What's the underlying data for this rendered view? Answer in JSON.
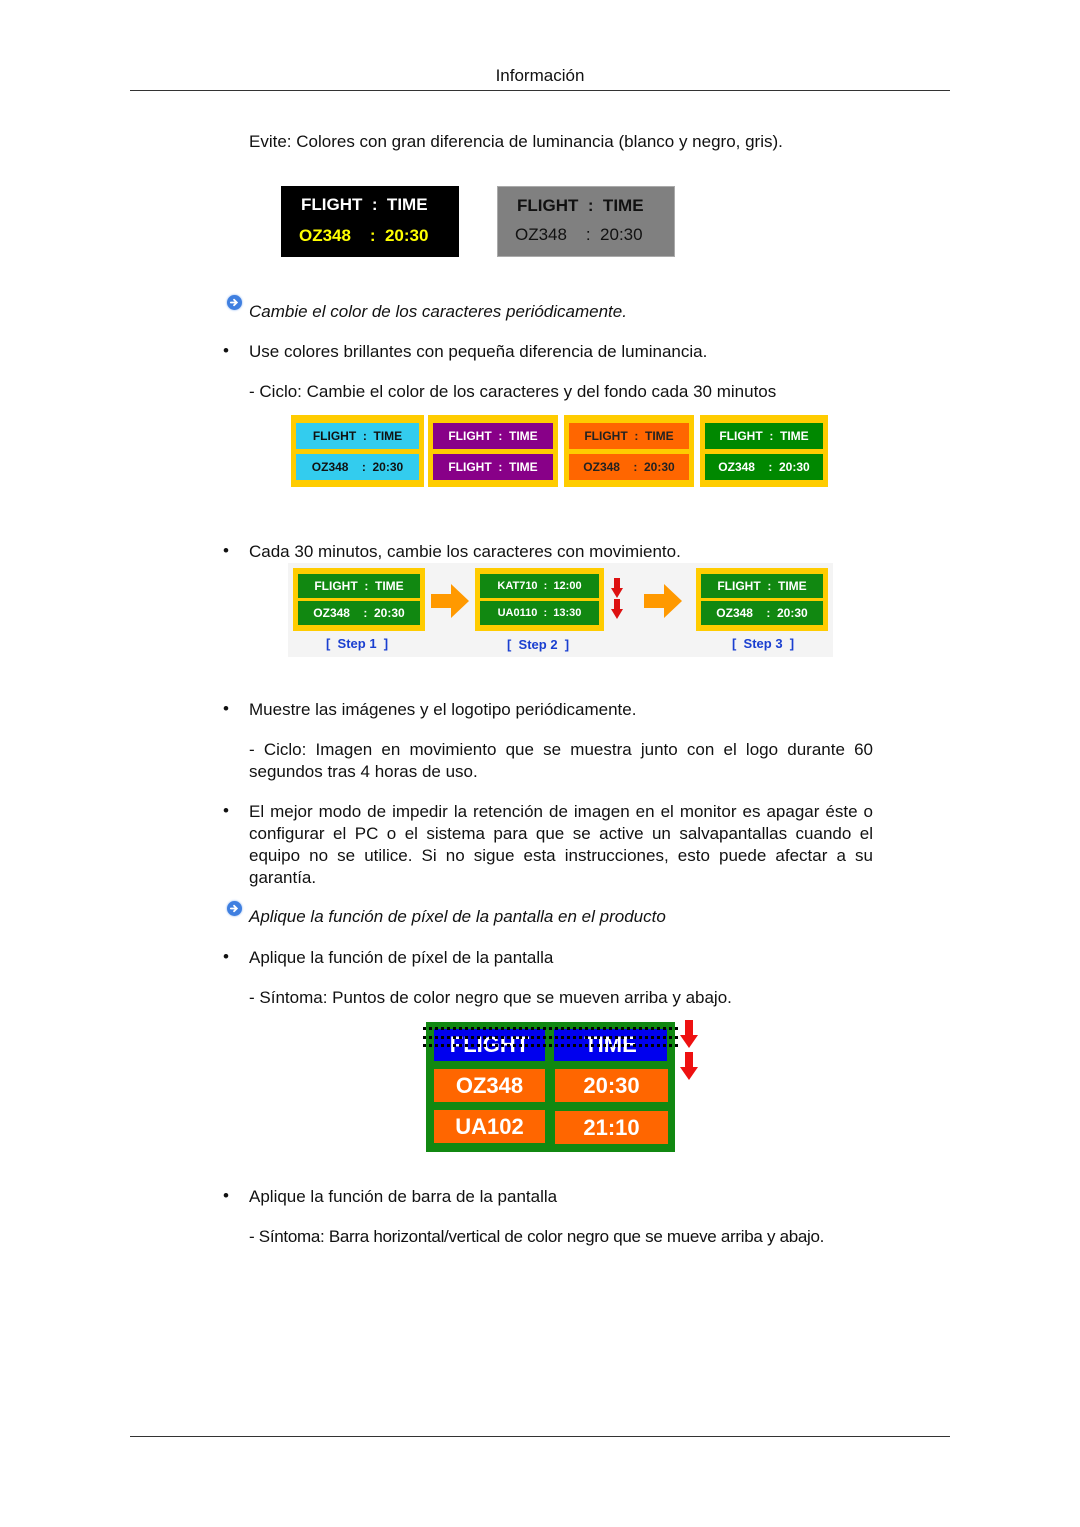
{
  "header": {
    "title": "Información"
  },
  "avoid_text": "Evite: Colores con gran diferencia de luminancia (blanco y negro, gris).",
  "avoid_boards": [
    {
      "line1": "FLIGHT  :  TIME",
      "line2": "OZ348    :  20:30",
      "bg": "#000000",
      "color1": "#ffffff",
      "color2": "#ffff00"
    },
    {
      "line1": "FLIGHT  :  TIME",
      "line2": "OZ348    :  20:30",
      "bg": "#808080",
      "color1": "#111111",
      "color2": "#111111"
    }
  ],
  "section1": {
    "icon": "arrow-right-circle-icon",
    "title": "Cambie el color de los caracteres periódicamente."
  },
  "bullet1": "Use colores brillantes con pequeña diferencia de luminancia.",
  "cycle1": "- Ciclo: Cambie el color de los caracteres y del fondo cada 30 minutos",
  "color_boards": [
    {
      "top": "FLIGHT  :  TIME",
      "bottom": "OZ348    :  20:30",
      "bg": "#33ccee",
      "fg": "#111111",
      "frame": "#ffcc00"
    },
    {
      "top": "FLIGHT  :  TIME",
      "bottom": "FLIGHT  :  TIME",
      "bg": "#880088",
      "fg": "#ffffff",
      "frame": "#ffcc00"
    },
    {
      "top": "FLIGHT  :  TIME",
      "bottom": "OZ348    :  20:30",
      "bg": "#ff6600",
      "fg": "#222222",
      "frame": "#ffcc00"
    },
    {
      "top": "FLIGHT  :  TIME",
      "bottom": "OZ348    :  20:30",
      "bg": "#008800",
      "fg": "#ffffff",
      "frame": "#ffcc00"
    }
  ],
  "bullet2": "Cada 30 minutos, cambie los caracteres con movimiento.",
  "steps": [
    {
      "label": "[  Step 1  ]",
      "top": "FLIGHT  :  TIME",
      "bottom": "OZ348    :  20:30"
    },
    {
      "label": "[  Step 2  ]",
      "top": "KAT710  :  12:00",
      "bottom": "UA0110  :  13:30"
    },
    {
      "label": "[  Step 3  ]",
      "top": "FLIGHT  :  TIME",
      "bottom": "OZ348    :  20:30"
    }
  ],
  "bullet3": "Muestre las imágenes y el logotipo periódicamente.",
  "cycle2": "- Ciclo: Imagen en movimiento que se muestra junto con el logo durante 60 segundos tras 4 horas de uso.",
  "bullet4": "El mejor modo de impedir la retención de imagen en el monitor es apagar éste o configurar el PC o el sistema para que se active un salvapantallas cuando el equipo no se utilice. Si no sigue esta instrucciones, esto puede afectar a su garantía.",
  "section2": {
    "icon": "arrow-right-circle-icon",
    "title": "Aplique la función de píxel de la pantalla en el producto"
  },
  "bullet5": "Aplique la función de píxel de la pantalla",
  "symptom1": "- Síntoma: Puntos de color negro que se mueven arriba y abajo.",
  "pixel_board": {
    "header": [
      "FLIGHT",
      "TIME"
    ],
    "rows": [
      [
        "OZ348",
        "20:30"
      ],
      [
        "UA102",
        "21:10"
      ]
    ],
    "header_bg": "#0000ee",
    "cell_bg": "#ff6600",
    "frame": "#118811"
  },
  "bullet6": "Aplique la función de barra de la pantalla",
  "symptom2": "- Síntoma: Barra horizontal/vertical de color negro que se mueve arriba y abajo.",
  "bullet_char": "•"
}
